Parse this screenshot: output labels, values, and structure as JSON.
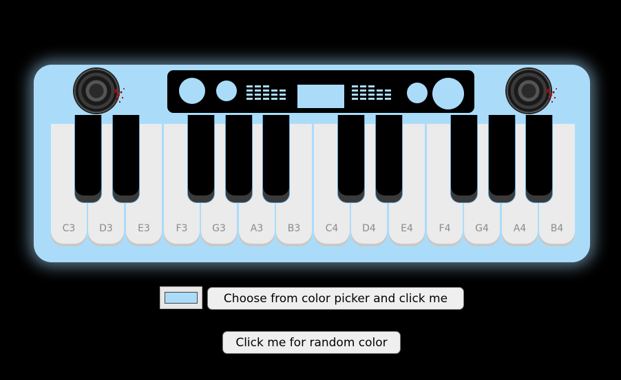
{
  "colors": {
    "background": "#000000",
    "keyboard": "#aadcfa",
    "panel": "#000000",
    "white_key": "#ebebeb",
    "black_key": "#000000",
    "key_label": "#8a8a8a",
    "picker_value": "#aadcfa"
  },
  "keyboard": {
    "white_keys": [
      {
        "note": "C3",
        "label": "C3"
      },
      {
        "note": "D3",
        "label": "D3"
      },
      {
        "note": "E3",
        "label": "E3"
      },
      {
        "note": "F3",
        "label": "F3"
      },
      {
        "note": "G3",
        "label": "G3"
      },
      {
        "note": "A3",
        "label": "A3"
      },
      {
        "note": "B3",
        "label": "B3"
      },
      {
        "note": "C4",
        "label": "C4"
      },
      {
        "note": "D4",
        "label": "D4"
      },
      {
        "note": "E4",
        "label": "E4"
      },
      {
        "note": "F4",
        "label": "F4"
      },
      {
        "note": "G4",
        "label": "G4"
      },
      {
        "note": "A4",
        "label": "A4"
      },
      {
        "note": "B4",
        "label": "B4"
      }
    ],
    "black_keys": [
      "C#3",
      "D#3",
      "F#3",
      "G#3",
      "A#3",
      "C#4",
      "D#4",
      "F#4",
      "G#4",
      "A#4"
    ],
    "speakers": [
      "speaker-icon",
      "speaker-icon"
    ]
  },
  "controls": {
    "picker_button_label": "Choose from color picker and click me",
    "random_button_label": "Click me for random color"
  }
}
